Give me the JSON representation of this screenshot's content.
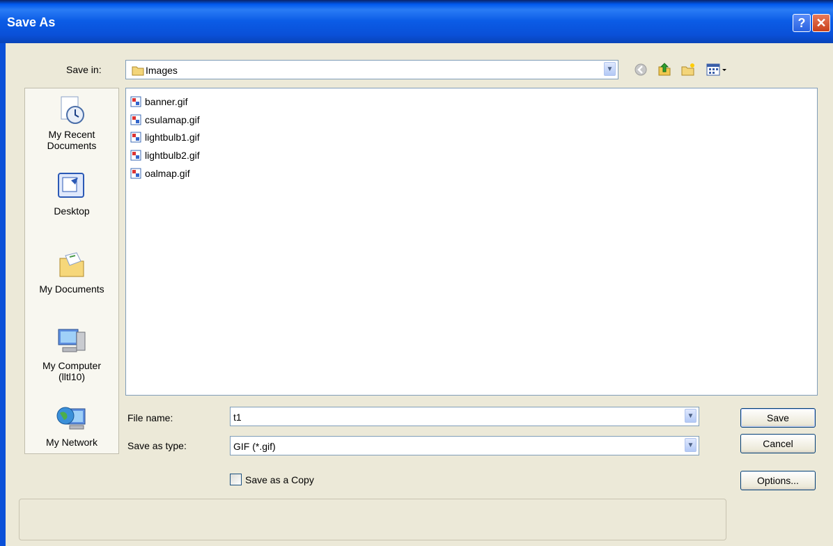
{
  "window": {
    "title": "Save As"
  },
  "toolbar": {
    "save_in_label": "Save in:",
    "save_in_value": "Images",
    "icons": [
      "back-icon",
      "up-folder-icon",
      "new-folder-icon",
      "views-menu-icon"
    ]
  },
  "places": [
    {
      "label_line1": "My Recent",
      "label_line2": "Documents",
      "icon": "recent-documents-icon"
    },
    {
      "label_line1": "Desktop",
      "label_line2": "",
      "icon": "desktop-icon"
    },
    {
      "label_line1": "My Documents",
      "label_line2": "",
      "icon": "my-documents-icon"
    },
    {
      "label_line1": "My Computer",
      "label_line2": "(lltl10)",
      "icon": "my-computer-icon"
    },
    {
      "label_line1": "My Network",
      "label_line2": "",
      "icon": "my-network-icon"
    }
  ],
  "files": [
    {
      "name": "banner.gif"
    },
    {
      "name": "csulamap.gif"
    },
    {
      "name": "lightbulb1.gif"
    },
    {
      "name": "lightbulb2.gif"
    },
    {
      "name": "oalmap.gif"
    }
  ],
  "form": {
    "file_name_label": "File name:",
    "file_name_value": "t1",
    "save_as_type_label": "Save as type:",
    "save_as_type_value": "GIF (*.gif)",
    "save_copy_label": "Save as a Copy",
    "save_copy_checked": false
  },
  "buttons": {
    "save": "Save",
    "cancel": "Cancel",
    "options": "Options..."
  },
  "colors": {
    "titlebar": "#0a50d8",
    "dialog_bg": "#ece9d8",
    "close": "#c8401a"
  }
}
